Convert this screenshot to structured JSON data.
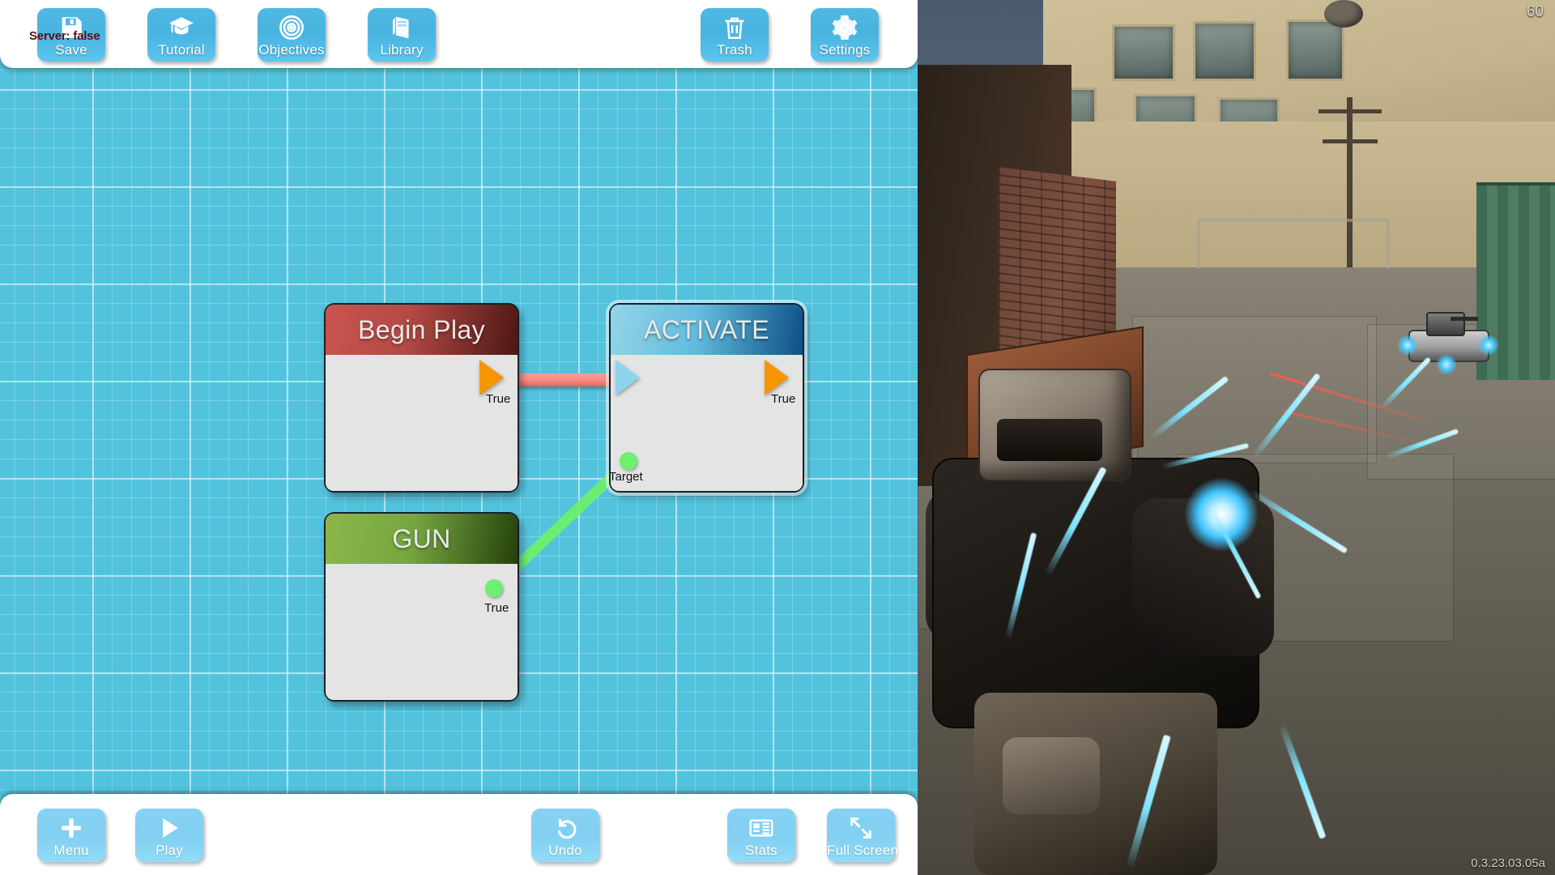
{
  "editor": {
    "server_status": "Server: false",
    "top_toolbar": [
      {
        "id": "save",
        "label": "Save",
        "icon": "floppy-disk-icon"
      },
      {
        "id": "tutorial",
        "label": "Tutorial",
        "icon": "graduation-cap-icon"
      },
      {
        "id": "objectives",
        "label": "Objectives",
        "icon": "target-icon"
      },
      {
        "id": "library",
        "label": "Library",
        "icon": "book-icon"
      },
      {
        "id": "trash",
        "label": "Trash",
        "icon": "trash-can-icon"
      },
      {
        "id": "settings",
        "label": "Settings",
        "icon": "gear-icon"
      }
    ],
    "bottom_toolbar": [
      {
        "id": "menu",
        "label": "Menu",
        "icon": "plus-icon"
      },
      {
        "id": "play",
        "label": "Play",
        "icon": "play-triangle-icon"
      },
      {
        "id": "undo",
        "label": "Undo",
        "icon": "undo-arrow-icon"
      },
      {
        "id": "stats",
        "label": "Stats",
        "icon": "stats-report-icon"
      },
      {
        "id": "fullscreen",
        "label": "Full Screen",
        "icon": "expand-arrows-icon"
      }
    ],
    "nodes": [
      {
        "id": "begin_play",
        "title": "Begin Play",
        "out_pin": "True"
      },
      {
        "id": "activate",
        "title": "ACTIVATE",
        "out_pin": "True",
        "in_data_pin": "Target"
      },
      {
        "id": "gun",
        "title": "GUN",
        "out_pin": "True"
      }
    ],
    "colors": {
      "canvas": "#53c3dd",
      "exec_wire": "#f8877f",
      "data_wire": "#6df06d",
      "exec_pin_out": "#f79500",
      "exec_pin_in": "#8ed4ef",
      "begin_play_header": "#b44a45",
      "activate_header": "#63bcdd",
      "gun_header": "#76a640",
      "button_blue": "#49b3e0"
    }
  },
  "game_view": {
    "fps": "60",
    "version": "0.3.23.03.05a"
  }
}
